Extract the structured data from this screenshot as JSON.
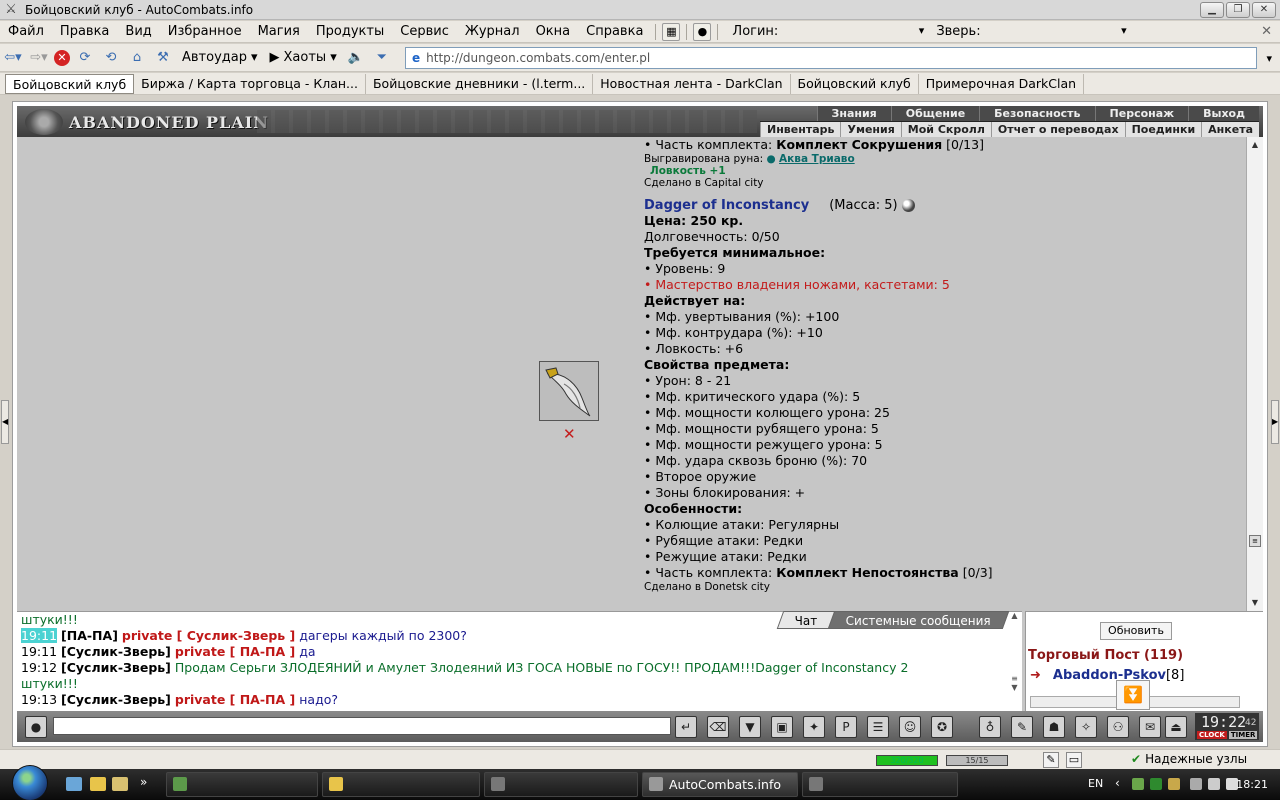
{
  "window": {
    "title": "Бойцовский клуб - AutoCombats.info"
  },
  "menu": {
    "items": [
      "Файл",
      "Правка",
      "Вид",
      "Избранное",
      "Магия",
      "Продукты",
      "Сервис",
      "Журнал",
      "Окна",
      "Справка"
    ],
    "login_label": "Логин:",
    "beast_label": "Зверь:"
  },
  "nav": {
    "autoudar": "Автоудар",
    "haoty": "Хаоты",
    "url": "http://dungeon.combats.com/enter.pl"
  },
  "tabs": [
    "Бойцовский клуб",
    "Биржа / Карта торговца - Клан...",
    "Бойцовские дневники - (l.term...",
    "Новостная лента - DarkClan",
    "Бойцовский клуб",
    "Примерочная DarkClan"
  ],
  "game": {
    "brand": "ABANDONED PLAIN",
    "topnav_row1": [
      "Знания",
      "Общение",
      "Безопасность",
      "Персонаж",
      "Выход"
    ],
    "topnav_row2": [
      "Инвентарь",
      "Умения",
      "Мой Скролл",
      "Отчет о переводах",
      "Поединки",
      "Анкета"
    ]
  },
  "item_prev": {
    "set_label": "• Часть комплекта:",
    "set_name": "Комплект Сокрушения",
    "set_count": "[0/13]",
    "rune_label": "Выгравирована руна:",
    "rune_name": "Аква Триаво",
    "rune_bonus": "Ловкость +1",
    "made": "Сделано в Capital city"
  },
  "item": {
    "name": "Dagger of Inconstancy",
    "mass": "(Масса: 5)",
    "price": "Цена: 250 кр.",
    "durability": "Долговечность: 0/50",
    "req_title": "Требуется минимальное:",
    "req_level": "• Уровень: 9",
    "req_skill": "• Мастерство владения ножами, кастетами: 5",
    "acts_title": "Действует на:",
    "acts": [
      "• Мф. увертывания (%): +100",
      "• Мф. контрудара (%): +10",
      "• Ловкость: +6"
    ],
    "props_title": "Свойства предмета:",
    "props": [
      "• Урон: 8 - 21",
      "• Мф. критического удара (%): 5",
      "• Мф. мощности колющего урона: 25",
      "• Мф. мощности рубящего урона: 5",
      "• Мф. мощности режущего урона: 5",
      "• Мф. удара сквозь броню (%): 70",
      "• Второе оружие",
      "• Зоны блокирования: +"
    ],
    "feat_title": "Особенности:",
    "feats": [
      "• Колющие атаки: Регулярны",
      "• Рубящие атаки: Редки",
      "• Режущие атаки: Редки"
    ],
    "set_label": "• Часть комплекта:",
    "set_name": "Комплект Непостоянства",
    "set_count": "[0/3]",
    "made": "Сделано в Donetsk city"
  },
  "chat": {
    "tabs": [
      "Чат",
      "Системные сообщения"
    ],
    "lines": [
      {
        "text": "штуки!!!"
      },
      {
        "time": "19:11",
        "nick": "[ПА-ПА]",
        "priv": "private [ Суслик-Зверь ]",
        "msg": "дагеры каждый по 2300?"
      },
      {
        "time": "19:11",
        "nick": "[Суслик-Зверь]",
        "priv": "private [ ПА-ПА ]",
        "msg": "да"
      },
      {
        "time": "19:12",
        "nick": "[Суслик-Зверь]",
        "msg": "Продам Серьги ЗЛОДЕЯНИЙ и Амулет Злодеяний ИЗ ГОСА НОВЫЕ по ГОСУ!! ПРОДАМ!!!Dagger of Inconstancy 2"
      },
      {
        "text": "штуки!!!"
      },
      {
        "time": "19:13",
        "nick": "[Суслик-Зверь]",
        "priv": "private [ ПА-ПА ]",
        "msg": "надо?"
      }
    ]
  },
  "trade": {
    "refresh": "Обновить",
    "title": "Торговый Пост (119)",
    "first_name": "Abaddon-Pskov",
    "first_level": "[8]"
  },
  "clock": {
    "time": "19:22",
    "seconds": "42",
    "clock_label": "CLOCK",
    "timer_label": "TIMER"
  },
  "status": {
    "hp": "320/320",
    "mana": "15/15",
    "safe": "Надежные узлы"
  },
  "taskbar": {
    "active_item": "AutoCombats.info",
    "lang": "EN",
    "time": "18:21"
  }
}
